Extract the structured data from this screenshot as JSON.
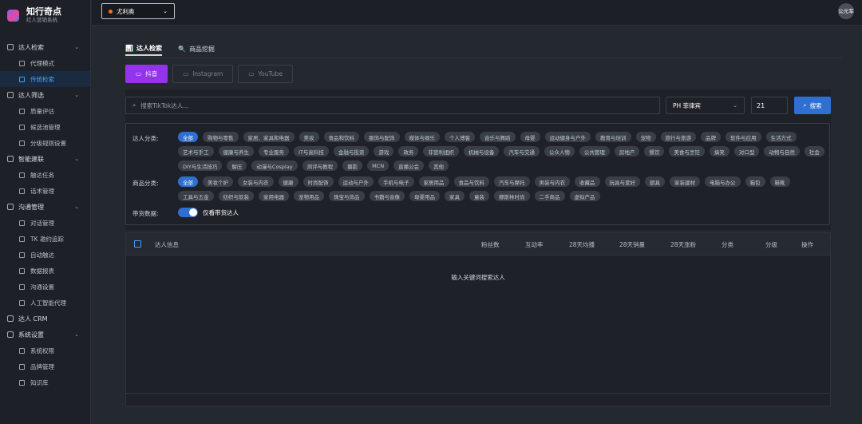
{
  "brand": {
    "title": "知行奇点",
    "subtitle": "红人营销系统"
  },
  "topbar": {
    "shop": "尤利奥",
    "avatar": "公元军"
  },
  "sidebar": {
    "groups": [
      {
        "label": "达人检索",
        "items": [
          "代理模式",
          "传统检索"
        ]
      },
      {
        "label": "达人筛选",
        "items": [
          "质量评估",
          "候选池管理",
          "分级规则设置"
        ]
      },
      {
        "label": "智能建联",
        "items": [
          "触达任务",
          "话术管理"
        ]
      },
      {
        "label": "沟通管理",
        "items": [
          "对话管理",
          "TK 邀约追踪",
          "自动触达",
          "数据报表",
          "沟通设置",
          "人工智能代理"
        ]
      },
      {
        "label": "达人 CRM",
        "items": []
      },
      {
        "label": "系统设置",
        "items": [
          "系统权限",
          "品牌管理",
          "知识库"
        ]
      }
    ]
  },
  "tabs": [
    {
      "icon": "📊",
      "label": "达人检索"
    },
    {
      "icon": "🔍",
      "label": "商品挖掘"
    }
  ],
  "platforms": [
    {
      "label": "抖音"
    },
    {
      "label": "Instagram"
    },
    {
      "label": "YouTube"
    }
  ],
  "search": {
    "placeholder": "搜索TikTok达人...",
    "region": "PH 菲律宾",
    "count": "21",
    "button": "搜索"
  },
  "filters": {
    "creator_label": "达人分类:",
    "creator_chips": [
      "全部",
      "购物与零售",
      "家居、家具和电器",
      "美妆",
      "食品和饮料",
      "服饰与配饰",
      "媒体与娱乐",
      "个人博客",
      "音乐与舞蹈",
      "母婴",
      "运动健身与户外",
      "教育与培训",
      "宠物",
      "旅行与旅游",
      "品牌",
      "软件与应用",
      "生活方式",
      "艺术与手工",
      "健康与养生",
      "专业服务",
      "IT与高科技",
      "金融与投资",
      "游戏",
      "政务",
      "非营利组织",
      "机械与设备",
      "汽车与交通",
      "公众人物",
      "公共管理",
      "房地产",
      "餐饮",
      "美食与烹饪",
      "搞笑",
      "对口型",
      "动物与自然",
      "社会",
      "DIY与生活技巧",
      "解压",
      "动漫与Cosplay",
      "测评与教程",
      "摄影",
      "MCN",
      "直播公会",
      "其他"
    ],
    "product_label": "商品分类:",
    "product_chips": [
      "全部",
      "美妆个护",
      "女装与内衣",
      "健康",
      "时尚配饰",
      "运动与户外",
      "手机与电子",
      "家居用品",
      "食品与饮料",
      "汽车与摩托",
      "男装与内衣",
      "收藏品",
      "玩具与爱好",
      "厨具",
      "家装建材",
      "电脑与办公",
      "箱包",
      "鞋靴",
      "工具与五金",
      "纺织与软装",
      "家用电器",
      "宠物用品",
      "珠宝与饰品",
      "书籍与音像",
      "母婴用品",
      "家具",
      "童装",
      "穆斯林时尚",
      "二手商品",
      "虚拟产品"
    ],
    "cargo_label": "带货数据:",
    "cargo_toggle": "仅看带货达人"
  },
  "table": {
    "columns": [
      "达人信息",
      "粉丝数",
      "互动率",
      "28天均播",
      "28天销量",
      "28天涨粉",
      "分类",
      "分级",
      "操作"
    ],
    "empty": "输入关键词搜索达人"
  },
  "colors": {
    "accent": "#2f6fd1",
    "douyin": "#9333ea",
    "active_nav": "#4a9cff"
  }
}
